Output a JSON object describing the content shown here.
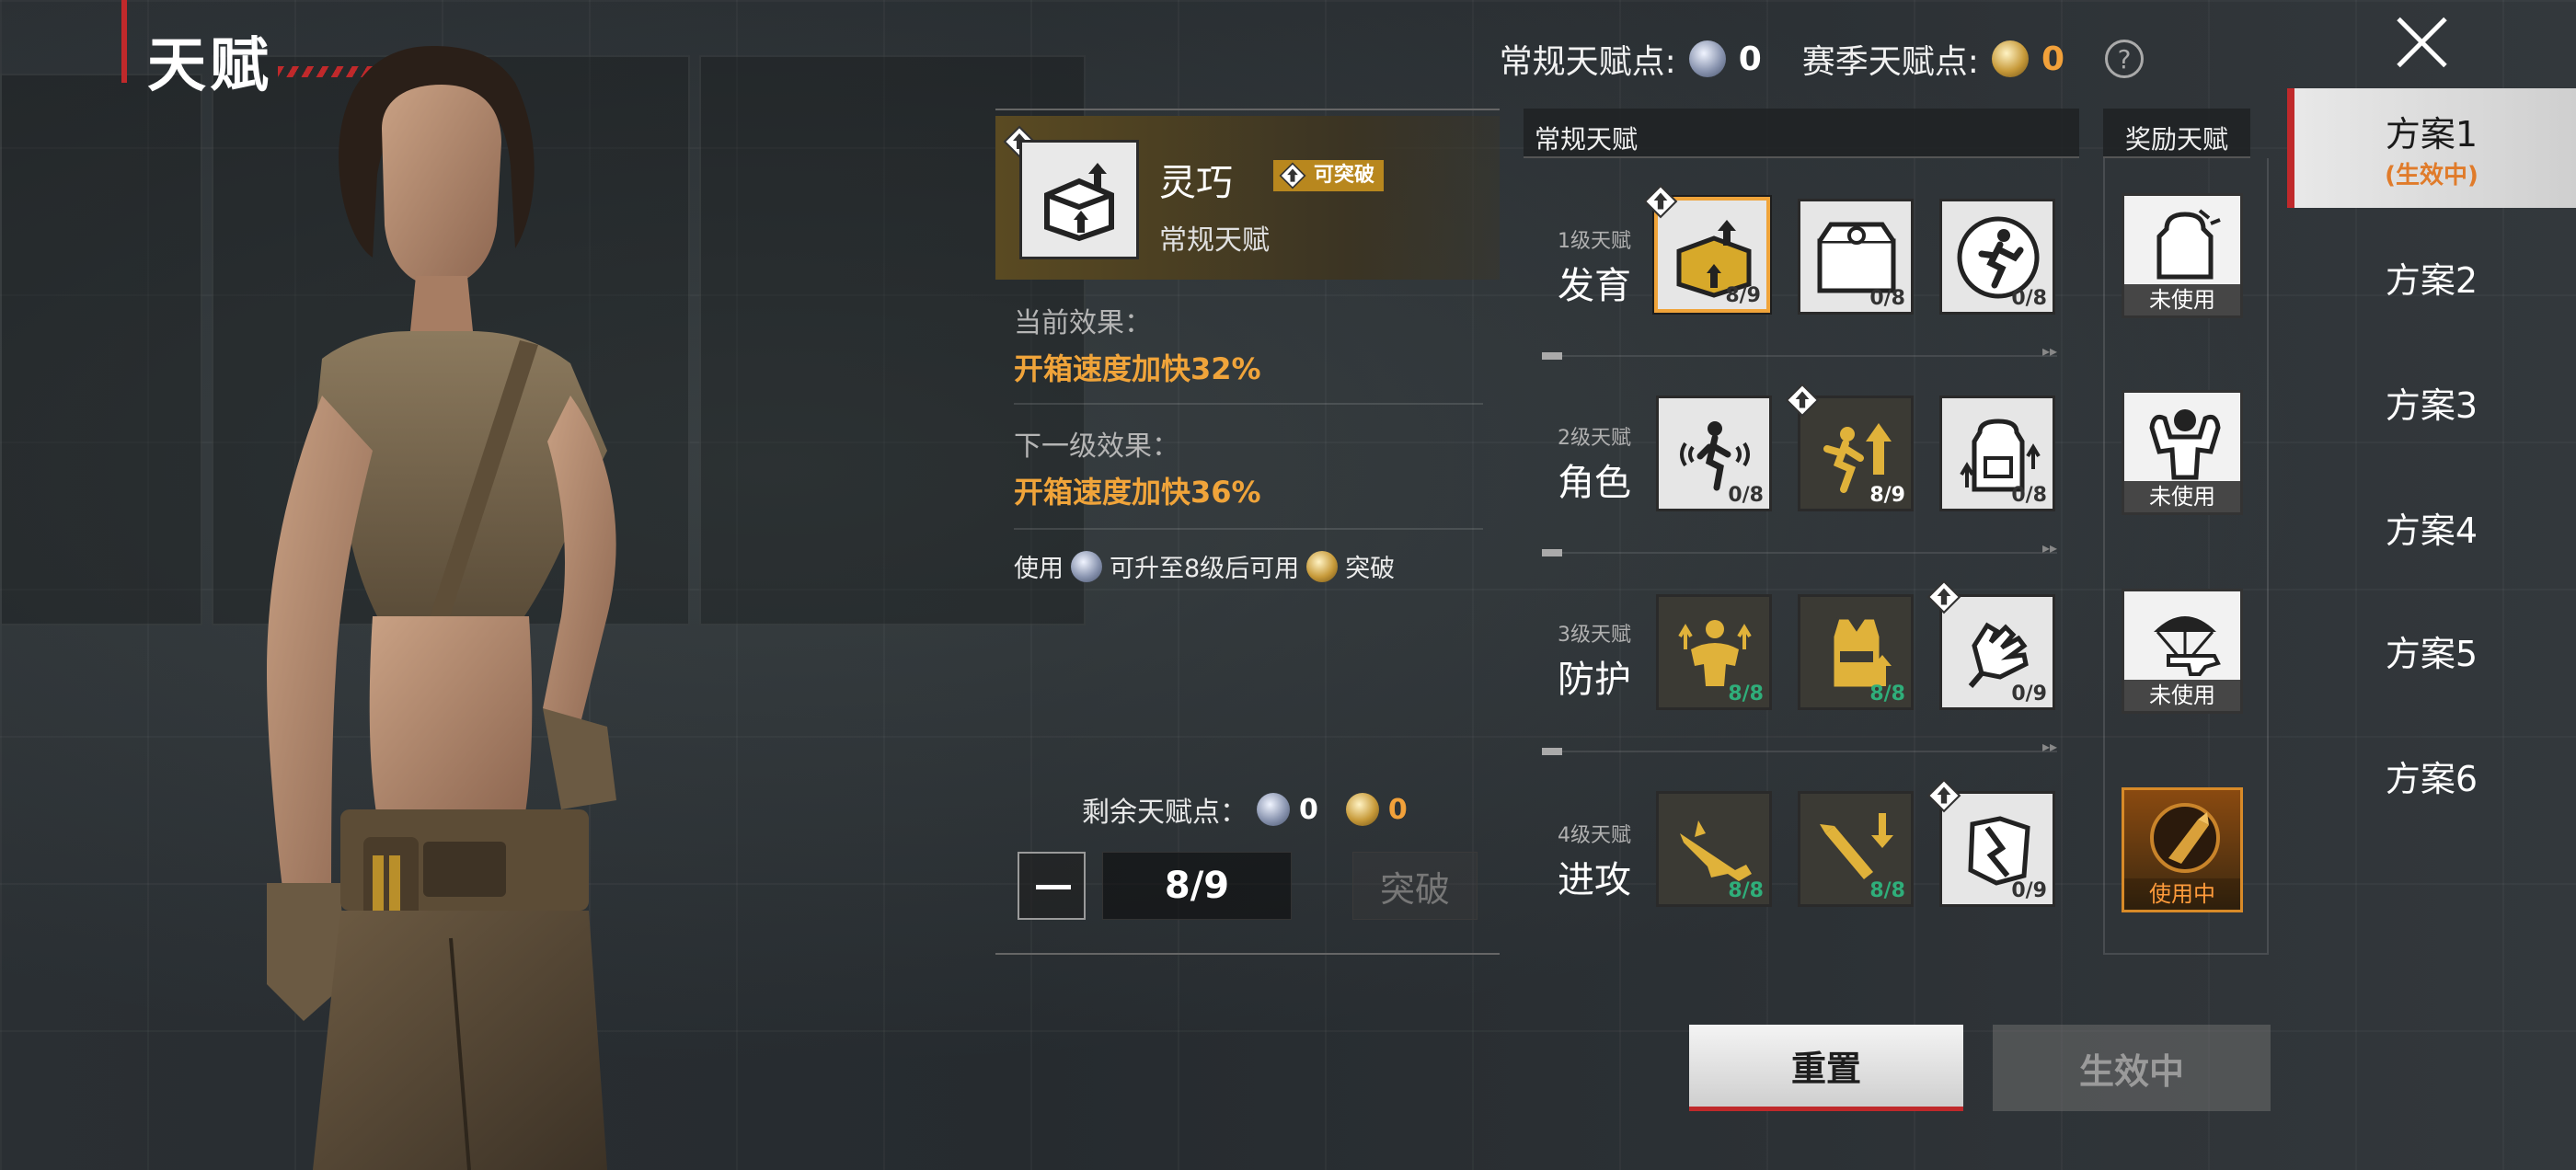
{
  "header": {
    "title": "天赋",
    "regular_points_label": "常规天赋点:",
    "regular_points_value": "0",
    "season_points_label": "赛季天赋点:",
    "season_points_value": "0",
    "help_glyph": "?"
  },
  "detail": {
    "name": "灵巧",
    "breakable_badge": "可突破",
    "type": "常规天赋",
    "current_effect_label": "当前效果：",
    "current_effect_value": "开箱速度加快32%",
    "next_effect_label": "下一级效果：",
    "next_effect_value": "开箱速度加快36%",
    "usage_prefix": "使用",
    "usage_middle": "可升至8级后可用",
    "usage_suffix": "突破",
    "remaining_label": "剩余天赋点：",
    "remaining_silver": "0",
    "remaining_gold": "0",
    "level": "8/9",
    "break_button": "突破"
  },
  "grid": {
    "regular_header": "常规天赋",
    "reward_header": "奖励天赋",
    "tiers": [
      {
        "level": "1级天赋",
        "name": "发育",
        "cells": [
          {
            "icon": "crate-open-icon",
            "count": "8/9"
          },
          {
            "icon": "supply-box-icon",
            "count": "0/8"
          },
          {
            "icon": "runner-icon",
            "count": "0/8"
          }
        ]
      },
      {
        "level": "2级天赋",
        "name": "角色",
        "cells": [
          {
            "icon": "footstep-sound-icon",
            "count": "0/8"
          },
          {
            "icon": "sprint-speed-icon",
            "count": "8/9"
          },
          {
            "icon": "backpack-icon",
            "count": "0/8"
          }
        ]
      },
      {
        "level": "3级天赋",
        "name": "防护",
        "cells": [
          {
            "icon": "strength-icon",
            "count": "8/8"
          },
          {
            "icon": "vest-icon",
            "count": "8/8"
          },
          {
            "icon": "glove-icon",
            "count": "0/9"
          }
        ]
      },
      {
        "level": "4级天赋",
        "name": "进攻",
        "cells": [
          {
            "icon": "rifle-icon",
            "count": "8/8"
          },
          {
            "icon": "ammo-icon",
            "count": "8/8"
          },
          {
            "icon": "armor-break-icon",
            "count": "0/9"
          }
        ]
      }
    ],
    "rewards": [
      {
        "icon": "bag-icon",
        "state": "未使用"
      },
      {
        "icon": "flex-icon",
        "state": "未使用"
      },
      {
        "icon": "airdrop-icon",
        "state": "未使用"
      },
      {
        "icon": "bullet-icon",
        "state": "使用中"
      }
    ]
  },
  "schemes": [
    {
      "label": "方案1",
      "sub": "(生效中)"
    },
    {
      "label": "方案2"
    },
    {
      "label": "方案3"
    },
    {
      "label": "方案4"
    },
    {
      "label": "方案5"
    },
    {
      "label": "方案6"
    }
  ],
  "buttons": {
    "reset": "重置",
    "active": "生效中"
  }
}
